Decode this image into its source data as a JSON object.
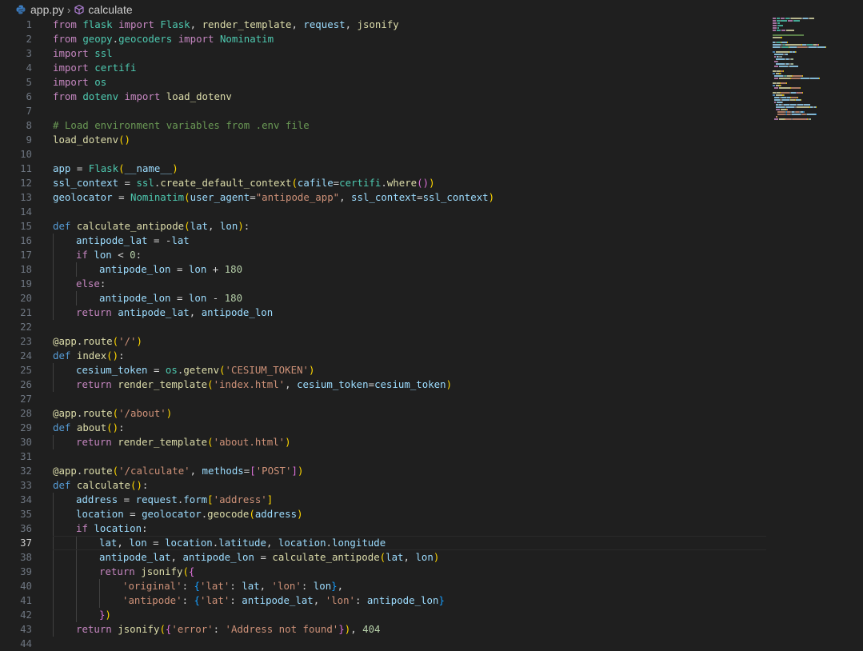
{
  "breadcrumb": {
    "file": "app.py",
    "symbol": "calculate"
  },
  "active_line": 37,
  "lines": [
    {
      "n": 1,
      "ind": 0,
      "t": [
        [
          "c",
          "from"
        ],
        [
          "p",
          " "
        ],
        [
          "m",
          "flask"
        ],
        [
          "p",
          " "
        ],
        [
          "c",
          "import"
        ],
        [
          "p",
          " "
        ],
        [
          "m",
          "Flask"
        ],
        [
          "p",
          ", "
        ],
        [
          "f",
          "render_template"
        ],
        [
          "p",
          ", "
        ],
        [
          "v",
          "request"
        ],
        [
          "p",
          ", "
        ],
        [
          "f",
          "jsonify"
        ]
      ]
    },
    {
      "n": 2,
      "ind": 0,
      "t": [
        [
          "c",
          "from"
        ],
        [
          "p",
          " "
        ],
        [
          "m",
          "geopy"
        ],
        [
          "p",
          "."
        ],
        [
          "m",
          "geocoders"
        ],
        [
          "p",
          " "
        ],
        [
          "c",
          "import"
        ],
        [
          "p",
          " "
        ],
        [
          "m",
          "Nominatim"
        ]
      ]
    },
    {
      "n": 3,
      "ind": 0,
      "t": [
        [
          "c",
          "import"
        ],
        [
          "p",
          " "
        ],
        [
          "m",
          "ssl"
        ]
      ]
    },
    {
      "n": 4,
      "ind": 0,
      "t": [
        [
          "c",
          "import"
        ],
        [
          "p",
          " "
        ],
        [
          "m",
          "certifi"
        ]
      ]
    },
    {
      "n": 5,
      "ind": 0,
      "t": [
        [
          "c",
          "import"
        ],
        [
          "p",
          " "
        ],
        [
          "m",
          "os"
        ]
      ]
    },
    {
      "n": 6,
      "ind": 0,
      "t": [
        [
          "c",
          "from"
        ],
        [
          "p",
          " "
        ],
        [
          "m",
          "dotenv"
        ],
        [
          "p",
          " "
        ],
        [
          "c",
          "import"
        ],
        [
          "p",
          " "
        ],
        [
          "f",
          "load_dotenv"
        ]
      ]
    },
    {
      "n": 7,
      "ind": 0,
      "t": []
    },
    {
      "n": 8,
      "ind": 0,
      "t": [
        [
          "cm",
          "# Load environment variables from .env file"
        ]
      ]
    },
    {
      "n": 9,
      "ind": 0,
      "t": [
        [
          "f",
          "load_dotenv"
        ],
        [
          "b1",
          "()"
        ]
      ]
    },
    {
      "n": 10,
      "ind": 0,
      "t": []
    },
    {
      "n": 11,
      "ind": 0,
      "t": [
        [
          "v",
          "app"
        ],
        [
          "p",
          " = "
        ],
        [
          "m",
          "Flask"
        ],
        [
          "b1",
          "("
        ],
        [
          "v",
          "__name__"
        ],
        [
          "b1",
          ")"
        ]
      ]
    },
    {
      "n": 12,
      "ind": 0,
      "t": [
        [
          "v",
          "ssl_context"
        ],
        [
          "p",
          " = "
        ],
        [
          "m",
          "ssl"
        ],
        [
          "p",
          "."
        ],
        [
          "f",
          "create_default_context"
        ],
        [
          "b1",
          "("
        ],
        [
          "v",
          "cafile"
        ],
        [
          "p",
          "="
        ],
        [
          "m",
          "certifi"
        ],
        [
          "p",
          "."
        ],
        [
          "f",
          "where"
        ],
        [
          "b2",
          "()"
        ],
        [
          "b1",
          ")"
        ]
      ]
    },
    {
      "n": 13,
      "ind": 0,
      "t": [
        [
          "v",
          "geolocator"
        ],
        [
          "p",
          " = "
        ],
        [
          "m",
          "Nominatim"
        ],
        [
          "b1",
          "("
        ],
        [
          "v",
          "user_agent"
        ],
        [
          "p",
          "="
        ],
        [
          "s",
          "\"antipode_app\""
        ],
        [
          "p",
          ", "
        ],
        [
          "v",
          "ssl_context"
        ],
        [
          "p",
          "="
        ],
        [
          "v",
          "ssl_context"
        ],
        [
          "b1",
          ")"
        ]
      ]
    },
    {
      "n": 14,
      "ind": 0,
      "t": []
    },
    {
      "n": 15,
      "ind": 0,
      "t": [
        [
          "k",
          "def"
        ],
        [
          "p",
          " "
        ],
        [
          "f",
          "calculate_antipode"
        ],
        [
          "b1",
          "("
        ],
        [
          "v",
          "lat"
        ],
        [
          "p",
          ", "
        ],
        [
          "v",
          "lon"
        ],
        [
          "b1",
          ")"
        ],
        [
          "p",
          ":"
        ]
      ]
    },
    {
      "n": 16,
      "ind": 1,
      "t": [
        [
          "v",
          "antipode_lat"
        ],
        [
          "p",
          " = -"
        ],
        [
          "v",
          "lat"
        ]
      ]
    },
    {
      "n": 17,
      "ind": 1,
      "t": [
        [
          "c",
          "if"
        ],
        [
          "p",
          " "
        ],
        [
          "v",
          "lon"
        ],
        [
          "p",
          " < "
        ],
        [
          "n",
          "0"
        ],
        [
          "p",
          ":"
        ]
      ]
    },
    {
      "n": 18,
      "ind": 2,
      "t": [
        [
          "v",
          "antipode_lon"
        ],
        [
          "p",
          " = "
        ],
        [
          "v",
          "lon"
        ],
        [
          "p",
          " + "
        ],
        [
          "n",
          "180"
        ]
      ]
    },
    {
      "n": 19,
      "ind": 1,
      "t": [
        [
          "c",
          "else"
        ],
        [
          "p",
          ":"
        ]
      ]
    },
    {
      "n": 20,
      "ind": 2,
      "t": [
        [
          "v",
          "antipode_lon"
        ],
        [
          "p",
          " = "
        ],
        [
          "v",
          "lon"
        ],
        [
          "p",
          " - "
        ],
        [
          "n",
          "180"
        ]
      ]
    },
    {
      "n": 21,
      "ind": 1,
      "t": [
        [
          "c",
          "return"
        ],
        [
          "p",
          " "
        ],
        [
          "v",
          "antipode_lat"
        ],
        [
          "p",
          ", "
        ],
        [
          "v",
          "antipode_lon"
        ]
      ]
    },
    {
      "n": 22,
      "ind": 0,
      "t": []
    },
    {
      "n": 23,
      "ind": 0,
      "t": [
        [
          "f",
          "@app"
        ],
        [
          "p",
          "."
        ],
        [
          "f",
          "route"
        ],
        [
          "b1",
          "("
        ],
        [
          "s",
          "'/'"
        ],
        [
          "b1",
          ")"
        ]
      ]
    },
    {
      "n": 24,
      "ind": 0,
      "t": [
        [
          "k",
          "def"
        ],
        [
          "p",
          " "
        ],
        [
          "f",
          "index"
        ],
        [
          "b1",
          "()"
        ],
        [
          "p",
          ":"
        ]
      ]
    },
    {
      "n": 25,
      "ind": 1,
      "t": [
        [
          "v",
          "cesium_token"
        ],
        [
          "p",
          " = "
        ],
        [
          "m",
          "os"
        ],
        [
          "p",
          "."
        ],
        [
          "f",
          "getenv"
        ],
        [
          "b1",
          "("
        ],
        [
          "s",
          "'CESIUM_TOKEN'"
        ],
        [
          "b1",
          ")"
        ]
      ]
    },
    {
      "n": 26,
      "ind": 1,
      "t": [
        [
          "c",
          "return"
        ],
        [
          "p",
          " "
        ],
        [
          "f",
          "render_template"
        ],
        [
          "b1",
          "("
        ],
        [
          "s",
          "'index.html'"
        ],
        [
          "p",
          ", "
        ],
        [
          "v",
          "cesium_token"
        ],
        [
          "p",
          "="
        ],
        [
          "v",
          "cesium_token"
        ],
        [
          "b1",
          ")"
        ]
      ]
    },
    {
      "n": 27,
      "ind": 0,
      "t": []
    },
    {
      "n": 28,
      "ind": 0,
      "t": [
        [
          "f",
          "@app"
        ],
        [
          "p",
          "."
        ],
        [
          "f",
          "route"
        ],
        [
          "b1",
          "("
        ],
        [
          "s",
          "'/about'"
        ],
        [
          "b1",
          ")"
        ]
      ]
    },
    {
      "n": 29,
      "ind": 0,
      "t": [
        [
          "k",
          "def"
        ],
        [
          "p",
          " "
        ],
        [
          "f",
          "about"
        ],
        [
          "b1",
          "()"
        ],
        [
          "p",
          ":"
        ]
      ]
    },
    {
      "n": 30,
      "ind": 1,
      "t": [
        [
          "c",
          "return"
        ],
        [
          "p",
          " "
        ],
        [
          "f",
          "render_template"
        ],
        [
          "b1",
          "("
        ],
        [
          "s",
          "'about.html'"
        ],
        [
          "b1",
          ")"
        ]
      ]
    },
    {
      "n": 31,
      "ind": 0,
      "t": []
    },
    {
      "n": 32,
      "ind": 0,
      "t": [
        [
          "f",
          "@app"
        ],
        [
          "p",
          "."
        ],
        [
          "f",
          "route"
        ],
        [
          "b1",
          "("
        ],
        [
          "s",
          "'/calculate'"
        ],
        [
          "p",
          ", "
        ],
        [
          "v",
          "methods"
        ],
        [
          "p",
          "="
        ],
        [
          "b2",
          "["
        ],
        [
          "s",
          "'POST'"
        ],
        [
          "b2",
          "]"
        ],
        [
          "b1",
          ")"
        ]
      ]
    },
    {
      "n": 33,
      "ind": 0,
      "t": [
        [
          "k",
          "def"
        ],
        [
          "p",
          " "
        ],
        [
          "f",
          "calculate"
        ],
        [
          "b1",
          "()"
        ],
        [
          "p",
          ":"
        ]
      ]
    },
    {
      "n": 34,
      "ind": 1,
      "t": [
        [
          "v",
          "address"
        ],
        [
          "p",
          " = "
        ],
        [
          "v",
          "request"
        ],
        [
          "p",
          "."
        ],
        [
          "v",
          "form"
        ],
        [
          "b1",
          "["
        ],
        [
          "s",
          "'address'"
        ],
        [
          "b1",
          "]"
        ]
      ]
    },
    {
      "n": 35,
      "ind": 1,
      "t": [
        [
          "v",
          "location"
        ],
        [
          "p",
          " = "
        ],
        [
          "v",
          "geolocator"
        ],
        [
          "p",
          "."
        ],
        [
          "f",
          "geocode"
        ],
        [
          "b1",
          "("
        ],
        [
          "v",
          "address"
        ],
        [
          "b1",
          ")"
        ]
      ]
    },
    {
      "n": 36,
      "ind": 1,
      "t": [
        [
          "c",
          "if"
        ],
        [
          "p",
          " "
        ],
        [
          "v",
          "location"
        ],
        [
          "p",
          ":"
        ]
      ]
    },
    {
      "n": 37,
      "ind": 2,
      "t": [
        [
          "v",
          "lat"
        ],
        [
          "p",
          ", "
        ],
        [
          "v",
          "lon"
        ],
        [
          "p",
          " = "
        ],
        [
          "v",
          "location"
        ],
        [
          "p",
          "."
        ],
        [
          "v",
          "latitude"
        ],
        [
          "p",
          ", "
        ],
        [
          "v",
          "location"
        ],
        [
          "p",
          "."
        ],
        [
          "v",
          "longitude"
        ]
      ]
    },
    {
      "n": 38,
      "ind": 2,
      "t": [
        [
          "v",
          "antipode_lat"
        ],
        [
          "p",
          ", "
        ],
        [
          "v",
          "antipode_lon"
        ],
        [
          "p",
          " = "
        ],
        [
          "f",
          "calculate_antipode"
        ],
        [
          "b1",
          "("
        ],
        [
          "v",
          "lat"
        ],
        [
          "p",
          ", "
        ],
        [
          "v",
          "lon"
        ],
        [
          "b1",
          ")"
        ]
      ]
    },
    {
      "n": 39,
      "ind": 2,
      "t": [
        [
          "c",
          "return"
        ],
        [
          "p",
          " "
        ],
        [
          "f",
          "jsonify"
        ],
        [
          "b1",
          "("
        ],
        [
          "b2",
          "{"
        ]
      ]
    },
    {
      "n": 40,
      "ind": 3,
      "t": [
        [
          "s",
          "'original'"
        ],
        [
          "p",
          ": "
        ],
        [
          "b3",
          "{"
        ],
        [
          "s",
          "'lat'"
        ],
        [
          "p",
          ": "
        ],
        [
          "v",
          "lat"
        ],
        [
          "p",
          ", "
        ],
        [
          "s",
          "'lon'"
        ],
        [
          "p",
          ": "
        ],
        [
          "v",
          "lon"
        ],
        [
          "b3",
          "}"
        ],
        [
          "p",
          ","
        ]
      ]
    },
    {
      "n": 41,
      "ind": 3,
      "t": [
        [
          "s",
          "'antipode'"
        ],
        [
          "p",
          ": "
        ],
        [
          "b3",
          "{"
        ],
        [
          "s",
          "'lat'"
        ],
        [
          "p",
          ": "
        ],
        [
          "v",
          "antipode_lat"
        ],
        [
          "p",
          ", "
        ],
        [
          "s",
          "'lon'"
        ],
        [
          "p",
          ": "
        ],
        [
          "v",
          "antipode_lon"
        ],
        [
          "b3",
          "}"
        ]
      ]
    },
    {
      "n": 42,
      "ind": 2,
      "t": [
        [
          "b2",
          "}"
        ],
        [
          "b1",
          ")"
        ]
      ]
    },
    {
      "n": 43,
      "ind": 1,
      "t": [
        [
          "c",
          "return"
        ],
        [
          "p",
          " "
        ],
        [
          "f",
          "jsonify"
        ],
        [
          "b1",
          "("
        ],
        [
          "b2",
          "{"
        ],
        [
          "s",
          "'error'"
        ],
        [
          "p",
          ": "
        ],
        [
          "s",
          "'Address not found'"
        ],
        [
          "b2",
          "}"
        ],
        [
          "b1",
          ")"
        ],
        [
          "p",
          ", "
        ],
        [
          "n",
          "404"
        ]
      ]
    },
    {
      "n": 44,
      "ind": 0,
      "t": []
    }
  ],
  "colors": {
    "background": "#1f1f1f",
    "keyword_def": "#569cd6",
    "keyword_control": "#c586c0",
    "class_module": "#4ec9b0",
    "function": "#dcdcaa",
    "variable": "#9cdcfe",
    "string": "#ce9178",
    "number": "#b5cea8",
    "comment": "#6a9955"
  }
}
